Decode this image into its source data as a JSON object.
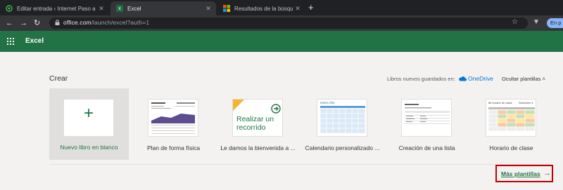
{
  "browser": {
    "tabs": [
      {
        "title": "Editar entrada ‹ Internet Paso a P",
        "favicon": "wordpress-icon",
        "close": "✕"
      },
      {
        "title": "Excel",
        "favicon": "excel-icon",
        "close": "✕"
      },
      {
        "title": "Resultados de la búsqueda - Offi",
        "favicon": "microsoft-icon",
        "close": "✕"
      }
    ],
    "new_tab": "+",
    "url_host": "office.com",
    "url_path": "/launch/excel?auth=1",
    "profile_label": "En p"
  },
  "app": {
    "name": "Excel",
    "accent": "#217346"
  },
  "create": {
    "title": "Crear",
    "saved_label": "Libros nuevos guardados en:",
    "saved_target": "OneDrive",
    "hide_templates": "Ocultar plantillas ˄",
    "blank": {
      "plus": "+",
      "label": "Nuevo libro en blanco"
    },
    "templates": [
      {
        "label": "Plan de forma física"
      },
      {
        "label": "Le damos la bienvenida a ...",
        "thumb_text": "Realizar un recorrido"
      },
      {
        "label": "Calendario personalizado ...",
        "thumb_title": "enero Año"
      },
      {
        "label": "Creación de una lista"
      },
      {
        "label": "Horario de clase",
        "thumb_title": "Mi horario de clase",
        "thumb_subtitle": "Semestre 4"
      }
    ],
    "more_templates": "Más plantillas",
    "more_arrow": "→"
  }
}
